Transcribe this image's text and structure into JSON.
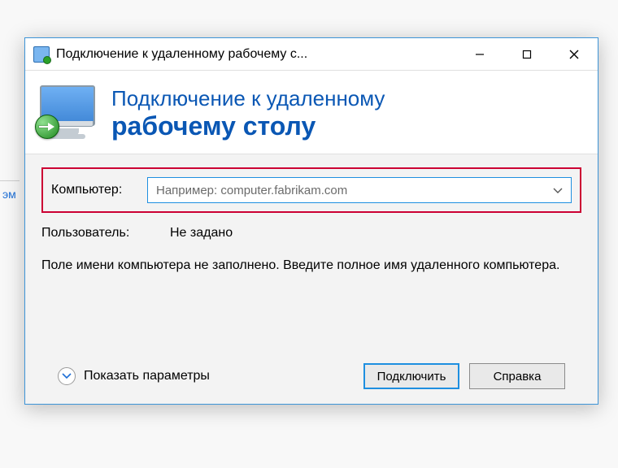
{
  "background_fragment": "эм",
  "titlebar": {
    "title": "Подключение к удаленному рабочему с..."
  },
  "header": {
    "line1": "Подключение к удаленному",
    "line2": "рабочему столу"
  },
  "form": {
    "computer_label": "Компьютер:",
    "computer_placeholder": "Например: computer.fabrikam.com",
    "user_label": "Пользователь:",
    "user_value": "Не задано",
    "hint": "Поле имени компьютера не заполнено. Введите полное имя удаленного компьютера."
  },
  "footer": {
    "show_params": "Показать параметры",
    "connect": "Подключить",
    "help": "Справка"
  }
}
